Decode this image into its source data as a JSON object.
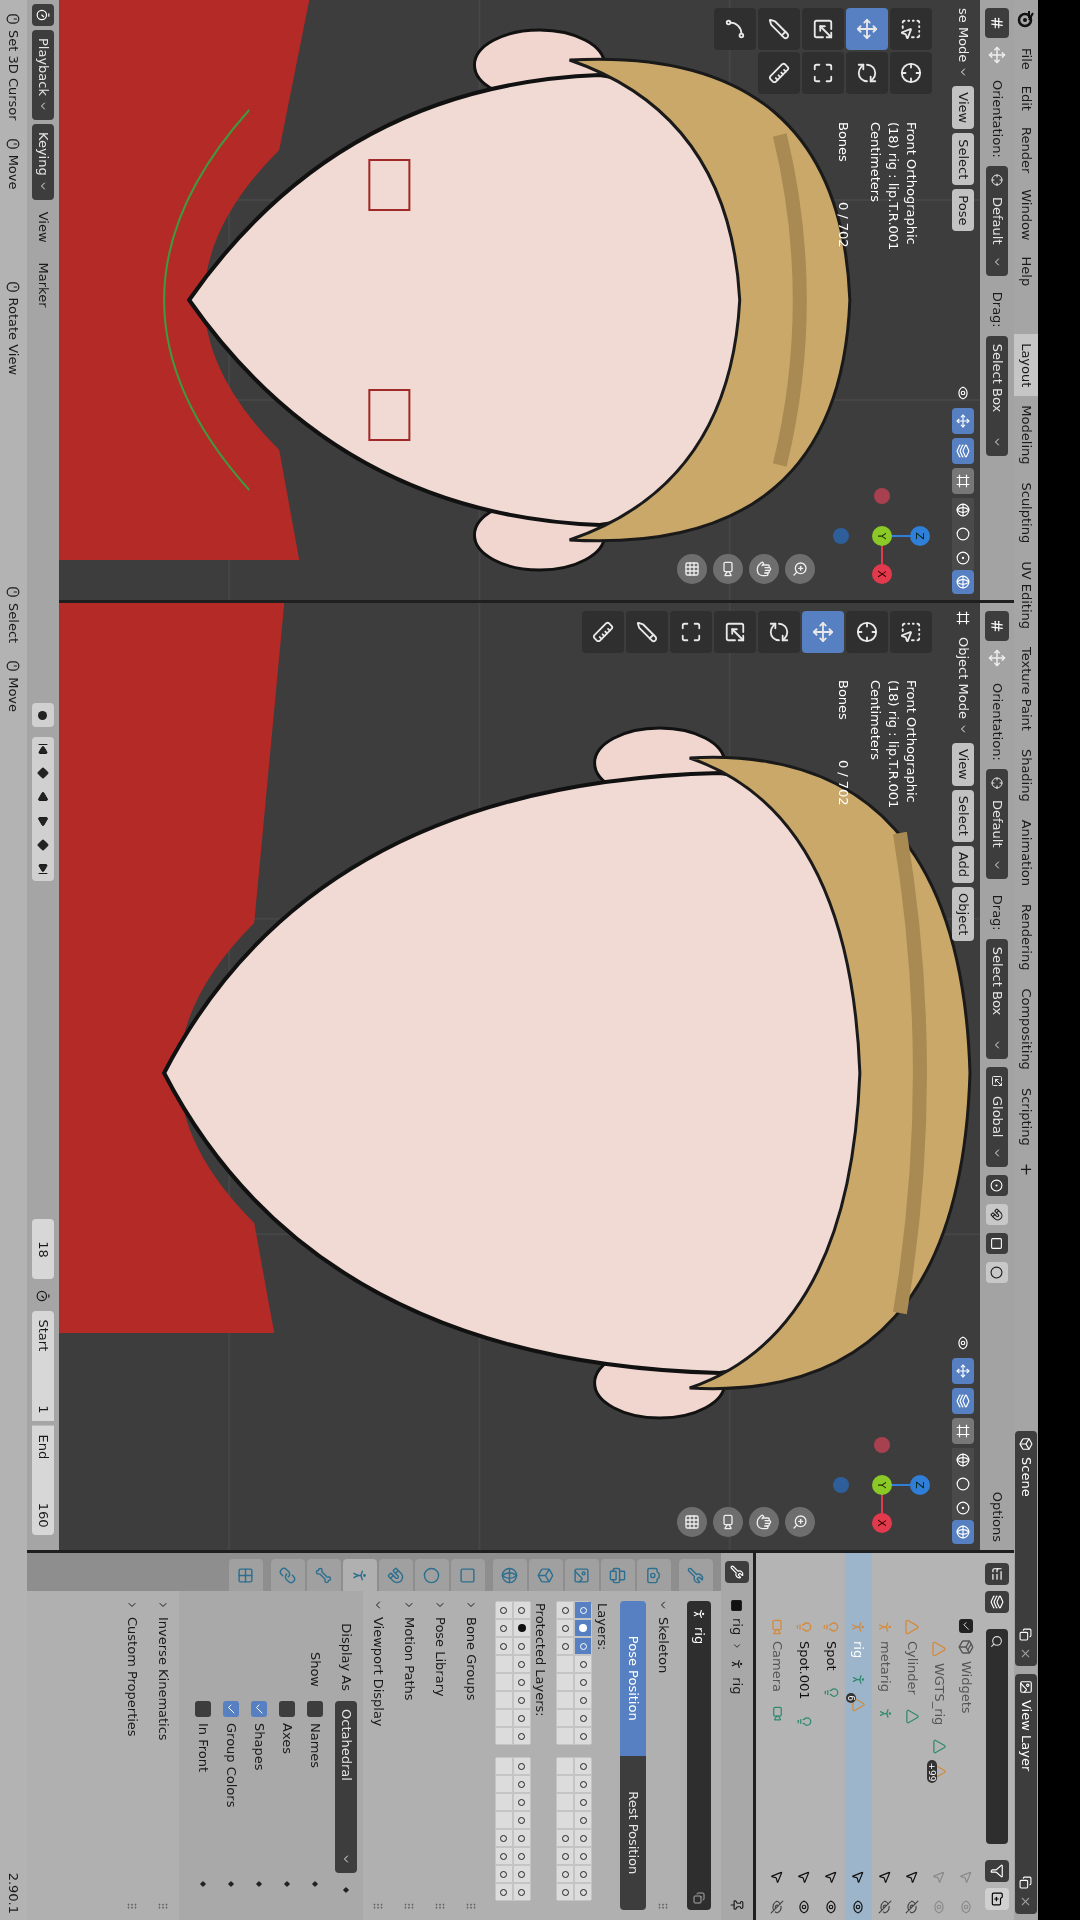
{
  "topbar": {
    "menus": [
      "File",
      "Edit",
      "Render",
      "Window",
      "Help"
    ],
    "workspaces": [
      {
        "label": "Layout",
        "selected": true
      },
      {
        "label": "Modeling",
        "selected": false
      },
      {
        "label": "Sculpting",
        "selected": false
      },
      {
        "label": "UV Editing",
        "selected": false
      },
      {
        "label": "Texture Paint",
        "selected": false
      },
      {
        "label": "Shading",
        "selected": false
      },
      {
        "label": "Animation",
        "selected": false
      },
      {
        "label": "Rendering",
        "selected": false
      },
      {
        "label": "Compositing",
        "selected": false
      },
      {
        "label": "Scripting",
        "selected": false
      }
    ],
    "add_workspace": "+",
    "scene": "Scene",
    "view_layer": "View Layer"
  },
  "viewports": [
    {
      "tool_settings": {
        "orientation_label": "Orientation:",
        "orientation": "Default",
        "drag_label": "Drag:",
        "drag": "Select Box"
      },
      "mode": "se Mode",
      "menus": [
        "View",
        "Select",
        "Pose"
      ],
      "toggles": [
        {
          "kind": "gizmos",
          "on": true
        },
        {
          "kind": "overlays",
          "on": true
        },
        {
          "kind": "xray",
          "on": false
        }
      ],
      "shading": [
        {
          "kind": "wireframe",
          "selected": false
        },
        {
          "kind": "solid",
          "selected": false
        },
        {
          "kind": "material",
          "selected": false
        },
        {
          "kind": "rendered",
          "selected": true
        }
      ],
      "tools": [
        {
          "kind": "select_box",
          "selected": false
        },
        {
          "kind": "cursor",
          "selected": false
        },
        {
          "kind": "move",
          "selected": true
        },
        {
          "kind": "rotate",
          "selected": false
        },
        {
          "kind": "scale",
          "selected": false
        },
        {
          "kind": "transform",
          "selected": false
        },
        {
          "kind": "annotate",
          "selected": false
        },
        {
          "kind": "measure",
          "selected": false
        },
        {
          "kind": "annotate_line",
          "selected": false
        }
      ],
      "info": [
        "Front Orthographic",
        "(18) rig : lip.T.R.001",
        "Centimeters"
      ],
      "stats": {
        "label": "Bones",
        "value": "0 / 702"
      },
      "axes": [
        "X",
        "Y",
        "Z"
      ]
    },
    {
      "tool_settings": {
        "orientation_label": "Orientation:",
        "orientation": "Default",
        "drag_label": "Drag:",
        "drag": "Select Box",
        "transform_orientation": "Global",
        "options": "Options"
      },
      "mode": "Object Mode",
      "menus": [
        "View",
        "Select",
        "Add",
        "Object"
      ],
      "toggles": [
        {
          "kind": "gizmos",
          "on": true
        },
        {
          "kind": "overlays",
          "on": true
        },
        {
          "kind": "xray",
          "on": false
        }
      ],
      "shading": [
        {
          "kind": "wireframe",
          "selected": false
        },
        {
          "kind": "solid",
          "selected": false
        },
        {
          "kind": "material",
          "selected": false
        },
        {
          "kind": "rendered",
          "selected": true
        }
      ],
      "tools": [
        {
          "kind": "select_box",
          "selected": false
        },
        {
          "kind": "cursor",
          "selected": false
        },
        {
          "kind": "move",
          "selected": true
        },
        {
          "kind": "rotate",
          "selected": false
        },
        {
          "kind": "scale",
          "selected": false
        },
        {
          "kind": "transform",
          "selected": false
        },
        {
          "kind": "annotate",
          "selected": false
        },
        {
          "kind": "measure",
          "selected": false
        }
      ],
      "info": [
        "Front Orthographic",
        "(18) rig : lip.T.R.001",
        "Centimeters"
      ],
      "stats": {
        "label": "Bones",
        "value": "0 / 702"
      },
      "axes": [
        "X",
        "Y",
        "Z"
      ]
    }
  ],
  "timeline": {
    "menus": [
      "Playback",
      "Keying"
    ],
    "items": [
      "View",
      "Marker"
    ],
    "current_frame": "18",
    "start_label": "Start",
    "start": "1",
    "end_label": "End",
    "end": "160"
  },
  "outliner": {
    "rows": [
      {
        "name": "Widgets",
        "kind": "collection",
        "checked": true,
        "selected": false,
        "hidden": false,
        "faded": true,
        "children": [
          {
            "name": "WGTS_rig",
            "kind": "mesh",
            "selected": false,
            "hidden": false,
            "faded": true,
            "badge": "+99"
          }
        ]
      },
      {
        "name": "Cylinder",
        "kind": "mesh",
        "selected": false,
        "hidden": true,
        "faded": true
      },
      {
        "name": "metarig",
        "kind": "armature",
        "selected": false,
        "hidden": true,
        "faded": true
      },
      {
        "name": "rig",
        "kind": "armature",
        "selected": true,
        "hidden": false,
        "faded": false,
        "badge": "6"
      },
      {
        "name": "Spot",
        "kind": "light",
        "selected": false,
        "hidden": false,
        "faded": false
      },
      {
        "name": "Spot.001",
        "kind": "light",
        "selected": false,
        "hidden": false,
        "faded": false
      },
      {
        "name": "Camera",
        "kind": "camera",
        "selected": false,
        "hidden": true,
        "faded": true
      }
    ]
  },
  "properties": {
    "tabs": [
      {
        "kind": "tool",
        "selected": false
      },
      {
        "kind": "render",
        "selected": false
      },
      {
        "kind": "output",
        "selected": false
      },
      {
        "kind": "view_layer",
        "selected": false
      },
      {
        "kind": "scene",
        "selected": false
      },
      {
        "kind": "world",
        "selected": false
      },
      {
        "kind": "object",
        "selected": false
      },
      {
        "kind": "physics",
        "selected": false
      },
      {
        "kind": "constraints",
        "selected": false
      },
      {
        "kind": "armature",
        "selected": true
      },
      {
        "kind": "bone",
        "selected": false
      },
      {
        "kind": "bone_constraints",
        "selected": false
      },
      {
        "kind": "texture",
        "selected": false
      }
    ],
    "breadcrumb": [
      "rig",
      "rig"
    ],
    "name": "rig",
    "panels": [
      {
        "kind": "skeleton",
        "title": "Skeleton",
        "expanded": true,
        "pose_options": [
          {
            "label": "Pose Position",
            "selected": true
          },
          {
            "label": "Rest Position",
            "selected": false
          }
        ],
        "layers_label": "Layers:",
        "layers": [
          [
            {
              "on": true,
              "bones": true,
              "active": false
            },
            {
              "on": true,
              "bones": true,
              "active": true
            },
            {
              "on": true,
              "bones": true,
              "active": false
            },
            {
              "on": false,
              "bones": true,
              "active": false
            },
            {
              "on": false,
              "bones": true,
              "active": false
            },
            {
              "on": false,
              "bones": true,
              "active": false
            },
            {
              "on": false,
              "bones": true,
              "active": false
            },
            {
              "on": false,
              "bones": true,
              "active": false
            },
            {
              "on": false,
              "bones": true,
              "active": false
            },
            {
              "on": false,
              "bones": true,
              "active": false
            },
            {
              "on": false,
              "bones": true,
              "active": false
            },
            {
              "on": false,
              "bones": true,
              "active": false
            },
            {
              "on": false,
              "bones": true,
              "active": false
            },
            {
              "on": false,
              "bones": true,
              "active": false
            },
            {
              "on": false,
              "bones": true,
              "active": false
            },
            {
              "on": false,
              "bones": true,
              "active": false
            }
          ],
          [
            {
              "on": false,
              "bones": true,
              "active": false
            },
            {
              "on": false,
              "bones": true,
              "active": false
            },
            {
              "on": false,
              "bones": true,
              "active": false
            },
            {
              "on": false,
              "bones": false,
              "active": false
            },
            {
              "on": false,
              "bones": false,
              "active": false
            },
            {
              "on": false,
              "bones": false,
              "active": false
            },
            {
              "on": false,
              "bones": false,
              "active": false
            },
            {
              "on": false,
              "bones": false,
              "active": false
            },
            {
              "on": false,
              "bones": false,
              "active": false
            },
            {
              "on": false,
              "bones": false,
              "active": false
            },
            {
              "on": false,
              "bones": false,
              "active": false
            },
            {
              "on": false,
              "bones": false,
              "active": false
            },
            {
              "on": false,
              "bones": true,
              "active": false
            },
            {
              "on": false,
              "bones": true,
              "active": false
            },
            {
              "on": false,
              "bones": true,
              "active": false
            },
            {
              "on": false,
              "bones": true,
              "active": false
            }
          ]
        ],
        "protected_label": "Protected Layers:",
        "protected": [
          [
            {
              "on": false,
              "bones": true,
              "active": false
            },
            {
              "on": false,
              "bones": true,
              "active": true
            },
            {
              "on": false,
              "bones": true,
              "active": false
            },
            {
              "on": false,
              "bones": true,
              "active": false
            },
            {
              "on": false,
              "bones": true,
              "active": false
            },
            {
              "on": false,
              "bones": true,
              "active": false
            },
            {
              "on": false,
              "bones": true,
              "active": false
            },
            {
              "on": false,
              "bones": true,
              "active": false
            },
            {
              "on": false,
              "bones": true,
              "active": false
            },
            {
              "on": false,
              "bones": true,
              "active": false
            },
            {
              "on": false,
              "bones": true,
              "active": false
            },
            {
              "on": false,
              "bones": true,
              "active": false
            },
            {
              "on": false,
              "bones": true,
              "active": false
            },
            {
              "on": false,
              "bones": true,
              "active": false
            },
            {
              "on": false,
              "bones": true,
              "active": false
            },
            {
              "on": false,
              "bones": true,
              "active": false
            }
          ],
          [
            {
              "on": false,
              "bones": true,
              "active": false
            },
            {
              "on": false,
              "bones": true,
              "active": false
            },
            {
              "on": false,
              "bones": true,
              "active": false
            },
            {
              "on": false,
              "bones": false,
              "active": false
            },
            {
              "on": false,
              "bones": false,
              "active": false
            },
            {
              "on": false,
              "bones": false,
              "active": false
            },
            {
              "on": false,
              "bones": false,
              "active": false
            },
            {
              "on": false,
              "bones": false,
              "active": false
            },
            {
              "on": false,
              "bones": false,
              "active": false
            },
            {
              "on": false,
              "bones": false,
              "active": false
            },
            {
              "on": false,
              "bones": false,
              "active": false
            },
            {
              "on": false,
              "bones": false,
              "active": false
            },
            {
              "on": false,
              "bones": true,
              "active": false
            },
            {
              "on": false,
              "bones": true,
              "active": false
            },
            {
              "on": false,
              "bones": true,
              "active": false
            },
            {
              "on": false,
              "bones": true,
              "active": false
            }
          ]
        ]
      },
      {
        "kind": "plain",
        "title": "Bone Groups",
        "expanded": false
      },
      {
        "kind": "plain",
        "title": "Pose Library",
        "expanded": false
      },
      {
        "kind": "plain",
        "title": "Motion Paths",
        "expanded": false
      },
      {
        "kind": "viewport_display",
        "title": "Viewport Display",
        "expanded": true,
        "display_as_label": "Display As",
        "display_as": "Octahedral",
        "show_label": "Show",
        "checks": [
          {
            "label": "Names",
            "checked": false
          },
          {
            "label": "Axes",
            "checked": false
          },
          {
            "label": "Shapes",
            "checked": true
          },
          {
            "label": "Group Colors",
            "checked": true
          },
          {
            "label": "In Front",
            "checked": false
          }
        ]
      },
      {
        "kind": "plain",
        "title": "Inverse Kinematics",
        "expanded": false
      },
      {
        "kind": "plain",
        "title": "Custom Properties",
        "expanded": false
      }
    ]
  },
  "status_bar": {
    "hints": [
      "Set 3D Cursor",
      "Move",
      "Rotate View",
      "Select",
      "Move"
    ],
    "version": "2.90.1"
  }
}
